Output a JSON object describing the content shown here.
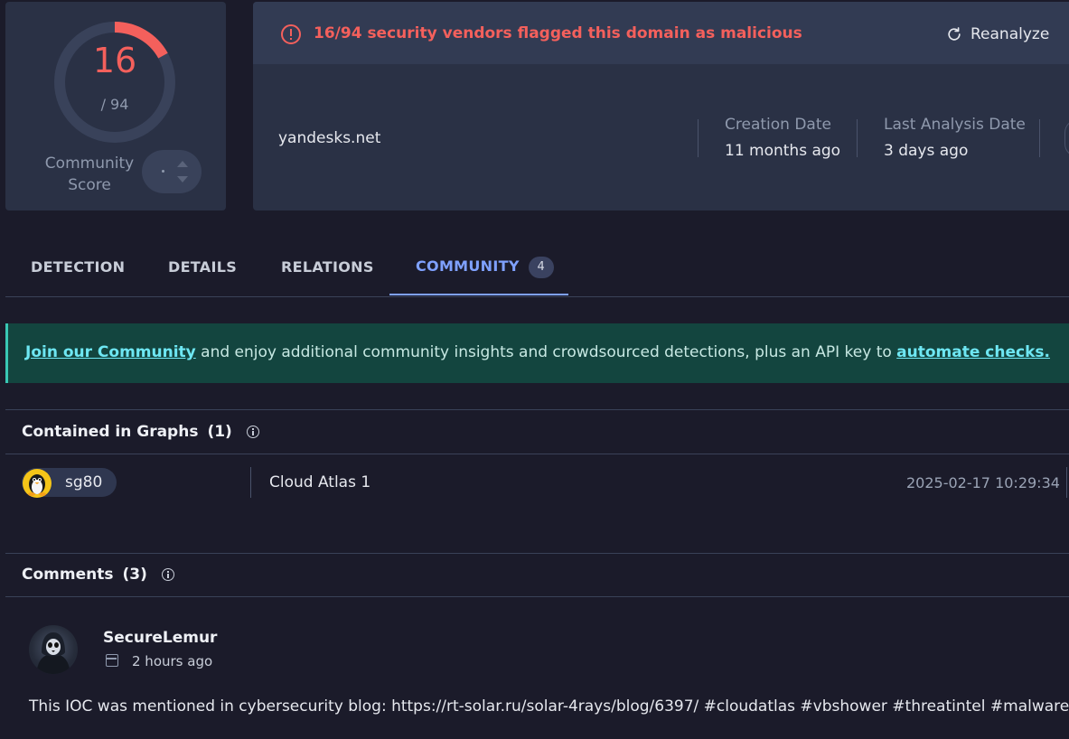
{
  "score": {
    "detected": "16",
    "total": "/ 94",
    "fraction": 0.17,
    "community_label_line1": "Community",
    "community_label_line2": "Score"
  },
  "alert": {
    "text": "16/94 security vendors flagged this domain as malicious",
    "reanalyze_label": "Reanalyze"
  },
  "domain": "yandesks.net",
  "meta": {
    "creation_date_label": "Creation Date",
    "creation_date_value": "11 months ago",
    "last_analysis_label": "Last Analysis Date",
    "last_analysis_value": "3 days ago"
  },
  "tabs": [
    {
      "label": "DETECTION"
    },
    {
      "label": "DETAILS"
    },
    {
      "label": "RELATIONS"
    },
    {
      "label": "COMMUNITY",
      "badge": "4",
      "active": true
    }
  ],
  "banner": {
    "link1": "Join our Community",
    "text_middle": " and enjoy additional community insights and crowdsourced detections, plus an API key to ",
    "link2": "automate checks."
  },
  "graphs": {
    "title": "Contained in Graphs",
    "count": "(1)",
    "row": {
      "user": "sg80",
      "graph_name": "Cloud Atlas 1",
      "timestamp": "2025-02-17 10:29:34"
    }
  },
  "comments": {
    "title": "Comments",
    "count": "(3)",
    "items": [
      {
        "user": "SecureLemur",
        "time": "2 hours ago",
        "text": "This IOC was mentioned in cybersecurity blog: https://rt-solar.ru/solar-4rays/blog/6397/ #cloudatlas #vbshower #threatintel #malware"
      }
    ]
  },
  "colors": {
    "malicious": "#f4605c",
    "accent": "#7fa1ff",
    "banner_bg": "#13453f",
    "banner_link": "#6ee7f3"
  }
}
